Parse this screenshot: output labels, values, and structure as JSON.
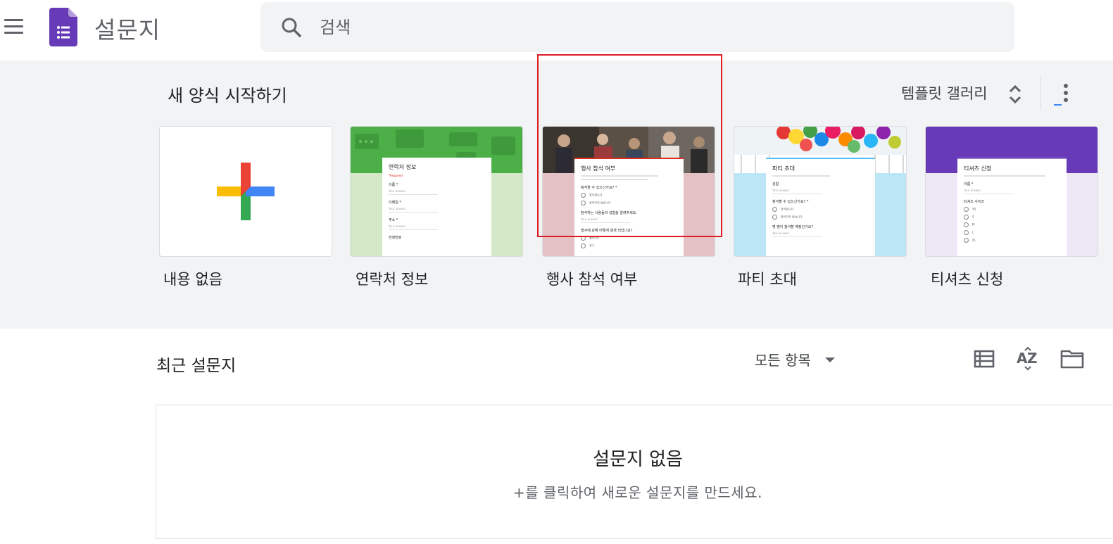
{
  "header": {
    "app_title": "설문지",
    "search_placeholder": "검색"
  },
  "templates": {
    "section_title": "새 양식 시작하기",
    "gallery_label": "템플릿 갤러리",
    "items": [
      {
        "label": "내용 없음"
      },
      {
        "label": "연락처 정보",
        "preview": {
          "title": "연락처 정보",
          "fields": [
            "이름 *",
            "이메일 *",
            "주소 *",
            "전화번호"
          ]
        }
      },
      {
        "label": "행사 참석 여부",
        "preview": {
          "title": "행사 참석 여부",
          "questions": [
            "참석할 수 있으신가요? *",
            "참석하는 사람들의 성함을 알려주세요.",
            "행사에 관해 어떻게 알게 되었나요?"
          ],
          "options": [
            "참석합니다",
            "참석하지 않습니다",
            "웹사이트",
            "친구"
          ]
        }
      },
      {
        "label": "파티 초대",
        "preview": {
          "title": "파티 초대",
          "questions": [
            "성함",
            "참석할 수 있으신가요? *",
            "몇 명이 참석할 예정인가요?"
          ],
          "options": [
            "참석합니다",
            "참석하지 않습니다"
          ]
        }
      },
      {
        "label": "티셔츠 신청",
        "preview": {
          "title": "티셔츠 신청",
          "questions": [
            "이름 *",
            "티셔츠 사이즈"
          ],
          "options": [
            "XS",
            "S",
            "M",
            "L",
            "XL"
          ]
        }
      }
    ]
  },
  "recent": {
    "title": "최근 설문지",
    "filter_label": "모든 항목",
    "empty_title": "설문지 없음",
    "empty_subtitle": "+를 클릭하여 새로운 설문지를 만드세요."
  },
  "colors": {
    "forms_purple": "#673ab7",
    "band_background": "#f1f3f4",
    "highlight": "#e01b24"
  }
}
